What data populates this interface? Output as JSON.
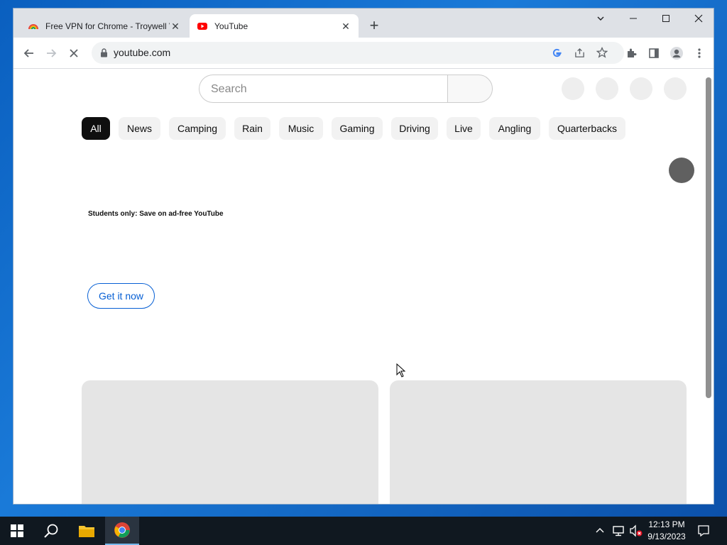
{
  "browser": {
    "tabs": [
      {
        "title": "Free VPN for Chrome - Troywell V",
        "active": false
      },
      {
        "title": "YouTube",
        "active": true
      }
    ],
    "address": "youtube.com"
  },
  "youtube": {
    "search_placeholder": "Search",
    "chips": [
      "All",
      "News",
      "Camping",
      "Rain",
      "Music",
      "Gaming",
      "Driving",
      "Live",
      "Angling",
      "Quarterbacks"
    ],
    "promo_text": "Students only: Save on ad-free YouTube",
    "promo_button": "Get it now"
  },
  "taskbar": {
    "time": "12:13 PM",
    "date": "9/13/2023"
  },
  "colors": {
    "chip_selected": "#0f0f0f",
    "accent_blue": "#065fd4",
    "desktop": "#0a5fbf"
  }
}
